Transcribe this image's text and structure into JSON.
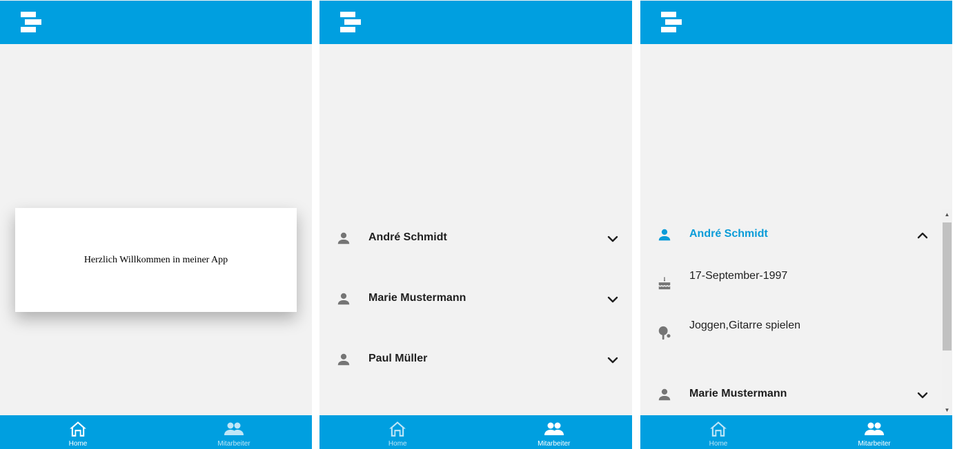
{
  "nav": {
    "home_label": "Home",
    "employees_label": "Mitarbeiter"
  },
  "home": {
    "welcome_text": "Herzlich Willkommen in meiner App"
  },
  "employees": [
    {
      "name": "André Schmidt",
      "birthday": "17-September-1997",
      "hobbies": "Joggen,Gitarre spielen"
    },
    {
      "name": "Marie Mustermann"
    },
    {
      "name": "Paul Müller"
    }
  ],
  "colors": {
    "primary": "#009fe0",
    "accent_text": "#0a9cd8",
    "background": "#f2f2f2",
    "icon_gray": "#757575"
  },
  "icons": {
    "logo": "app-logo-icon",
    "home": "home-icon",
    "employees": "people-icon",
    "person": "person-icon",
    "expand": "chevron-down-icon",
    "collapse": "chevron-up-icon",
    "birthday": "cake-icon",
    "hobby": "ping-pong-icon"
  }
}
